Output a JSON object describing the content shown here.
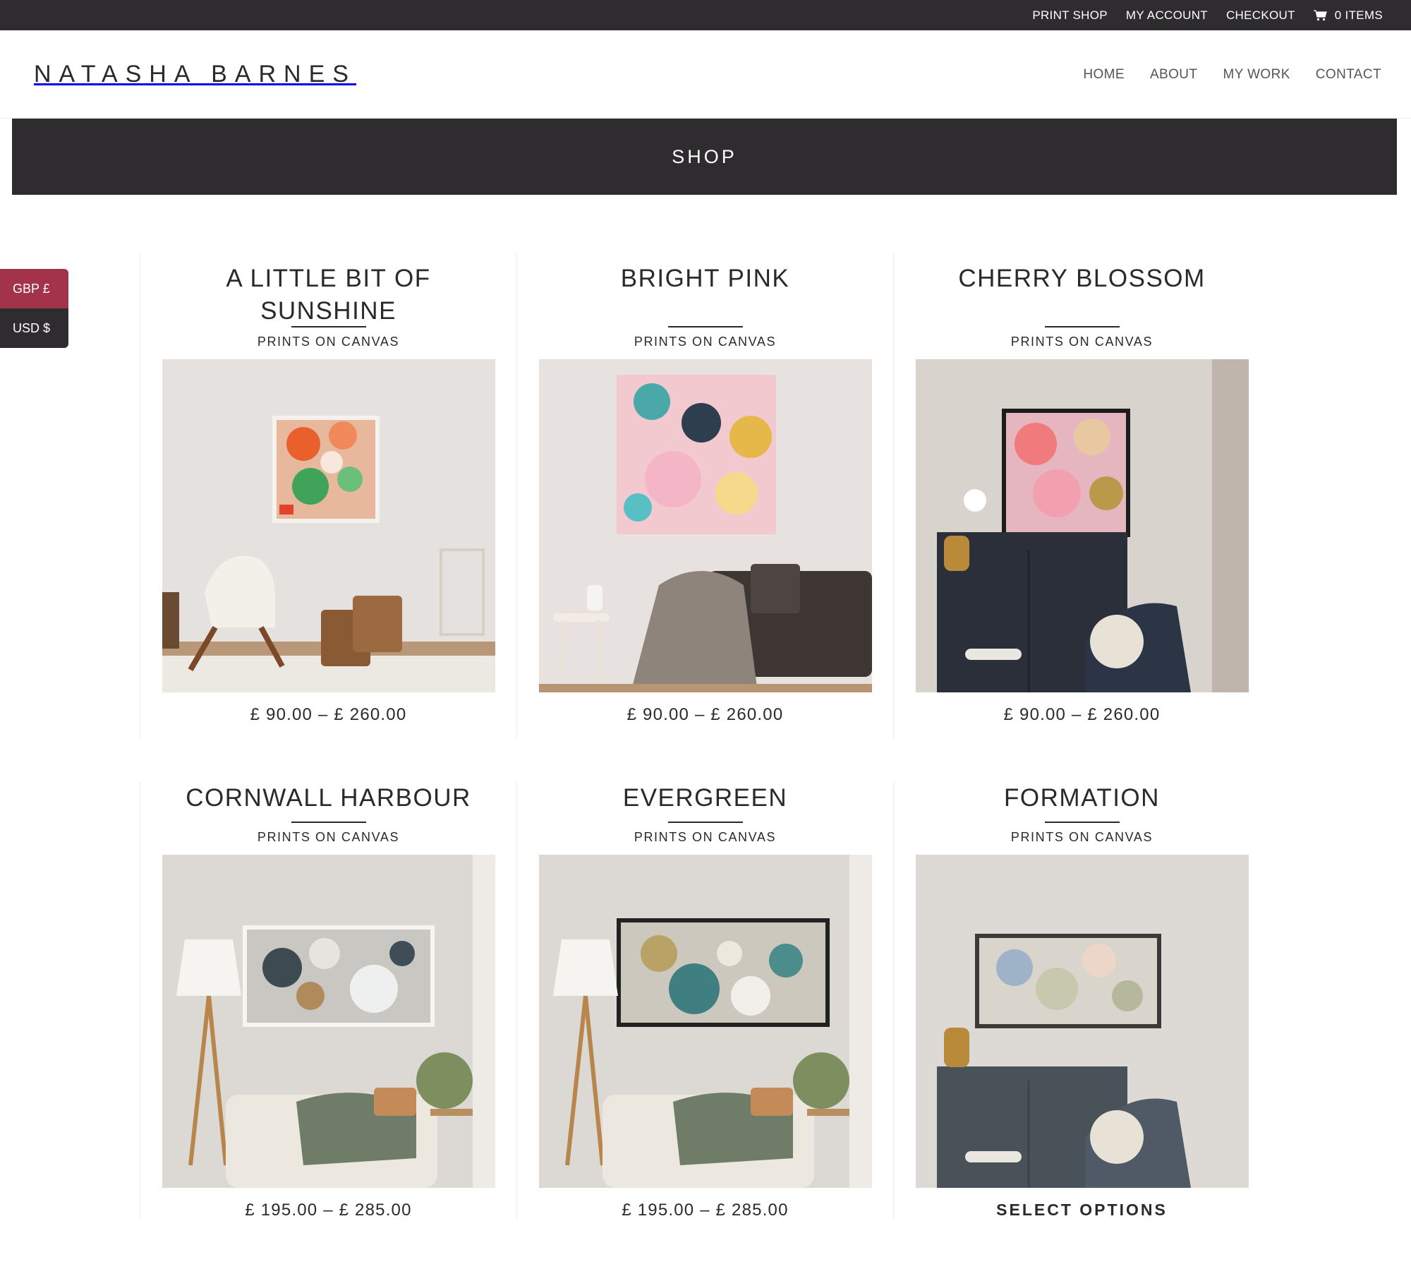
{
  "topbar": {
    "links": [
      "PRINT SHOP",
      "MY ACCOUNT",
      "CHECKOUT"
    ],
    "cart_label": "0 ITEMS"
  },
  "header": {
    "logo": "NATASHA BARNES",
    "nav": [
      "HOME",
      "ABOUT",
      "MY WORK",
      "CONTACT"
    ]
  },
  "banner": {
    "title": "SHOP"
  },
  "currency": {
    "options": [
      "GBP £",
      "USD $"
    ],
    "selected": "GBP £"
  },
  "products": [
    {
      "title": "A LITTLE BIT OF SUNSHINE",
      "subtitle": "PRINTS ON CANVAS",
      "price": "£ 90.00 – £ 260.00"
    },
    {
      "title": "BRIGHT PINK",
      "subtitle": "PRINTS ON CANVAS",
      "price": "£ 90.00 – £ 260.00"
    },
    {
      "title": "CHERRY BLOSSOM",
      "subtitle": "PRINTS ON CANVAS",
      "price": "£ 90.00 – £ 260.00"
    },
    {
      "title": "CORNWALL HARBOUR",
      "subtitle": "PRINTS ON CANVAS",
      "price": "£ 195.00 – £ 285.00"
    },
    {
      "title": "EVERGREEN",
      "subtitle": "PRINTS ON CANVAS",
      "price": "£ 195.00 – £ 285.00"
    },
    {
      "title": "FORMATION",
      "subtitle": "PRINTS ON CANVAS",
      "action": "SELECT OPTIONS"
    }
  ],
  "colors": {
    "dark_bar": "#2e2c2e",
    "currency_active": "#a3334b",
    "text": "#2b2a2b"
  },
  "icons": {
    "cart": "shopping-cart-icon"
  }
}
